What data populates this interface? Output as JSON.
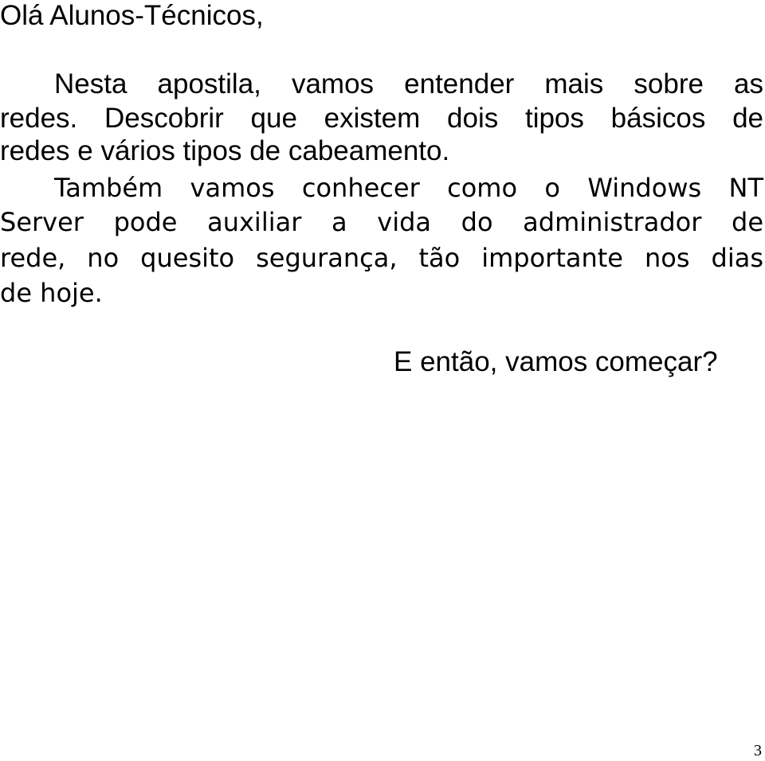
{
  "greeting": "Olá Alunos-Técnicos,",
  "paragraph1": {
    "lines": [
      "Nesta apostila, vamos entender mais sobre as",
      "redes. Descobrir que existem dois tipos básicos de",
      "redes e vários tipos de cabeamento."
    ]
  },
  "paragraph2": {
    "lines": [
      "Também vamos conhecer como o Windows NT",
      "Server pode auxiliar a vida do administrador de",
      "rede, no quesito segurança, tão importante nos dias",
      "de hoje."
    ]
  },
  "closing": "E então, vamos começar?",
  "page_number": "3"
}
